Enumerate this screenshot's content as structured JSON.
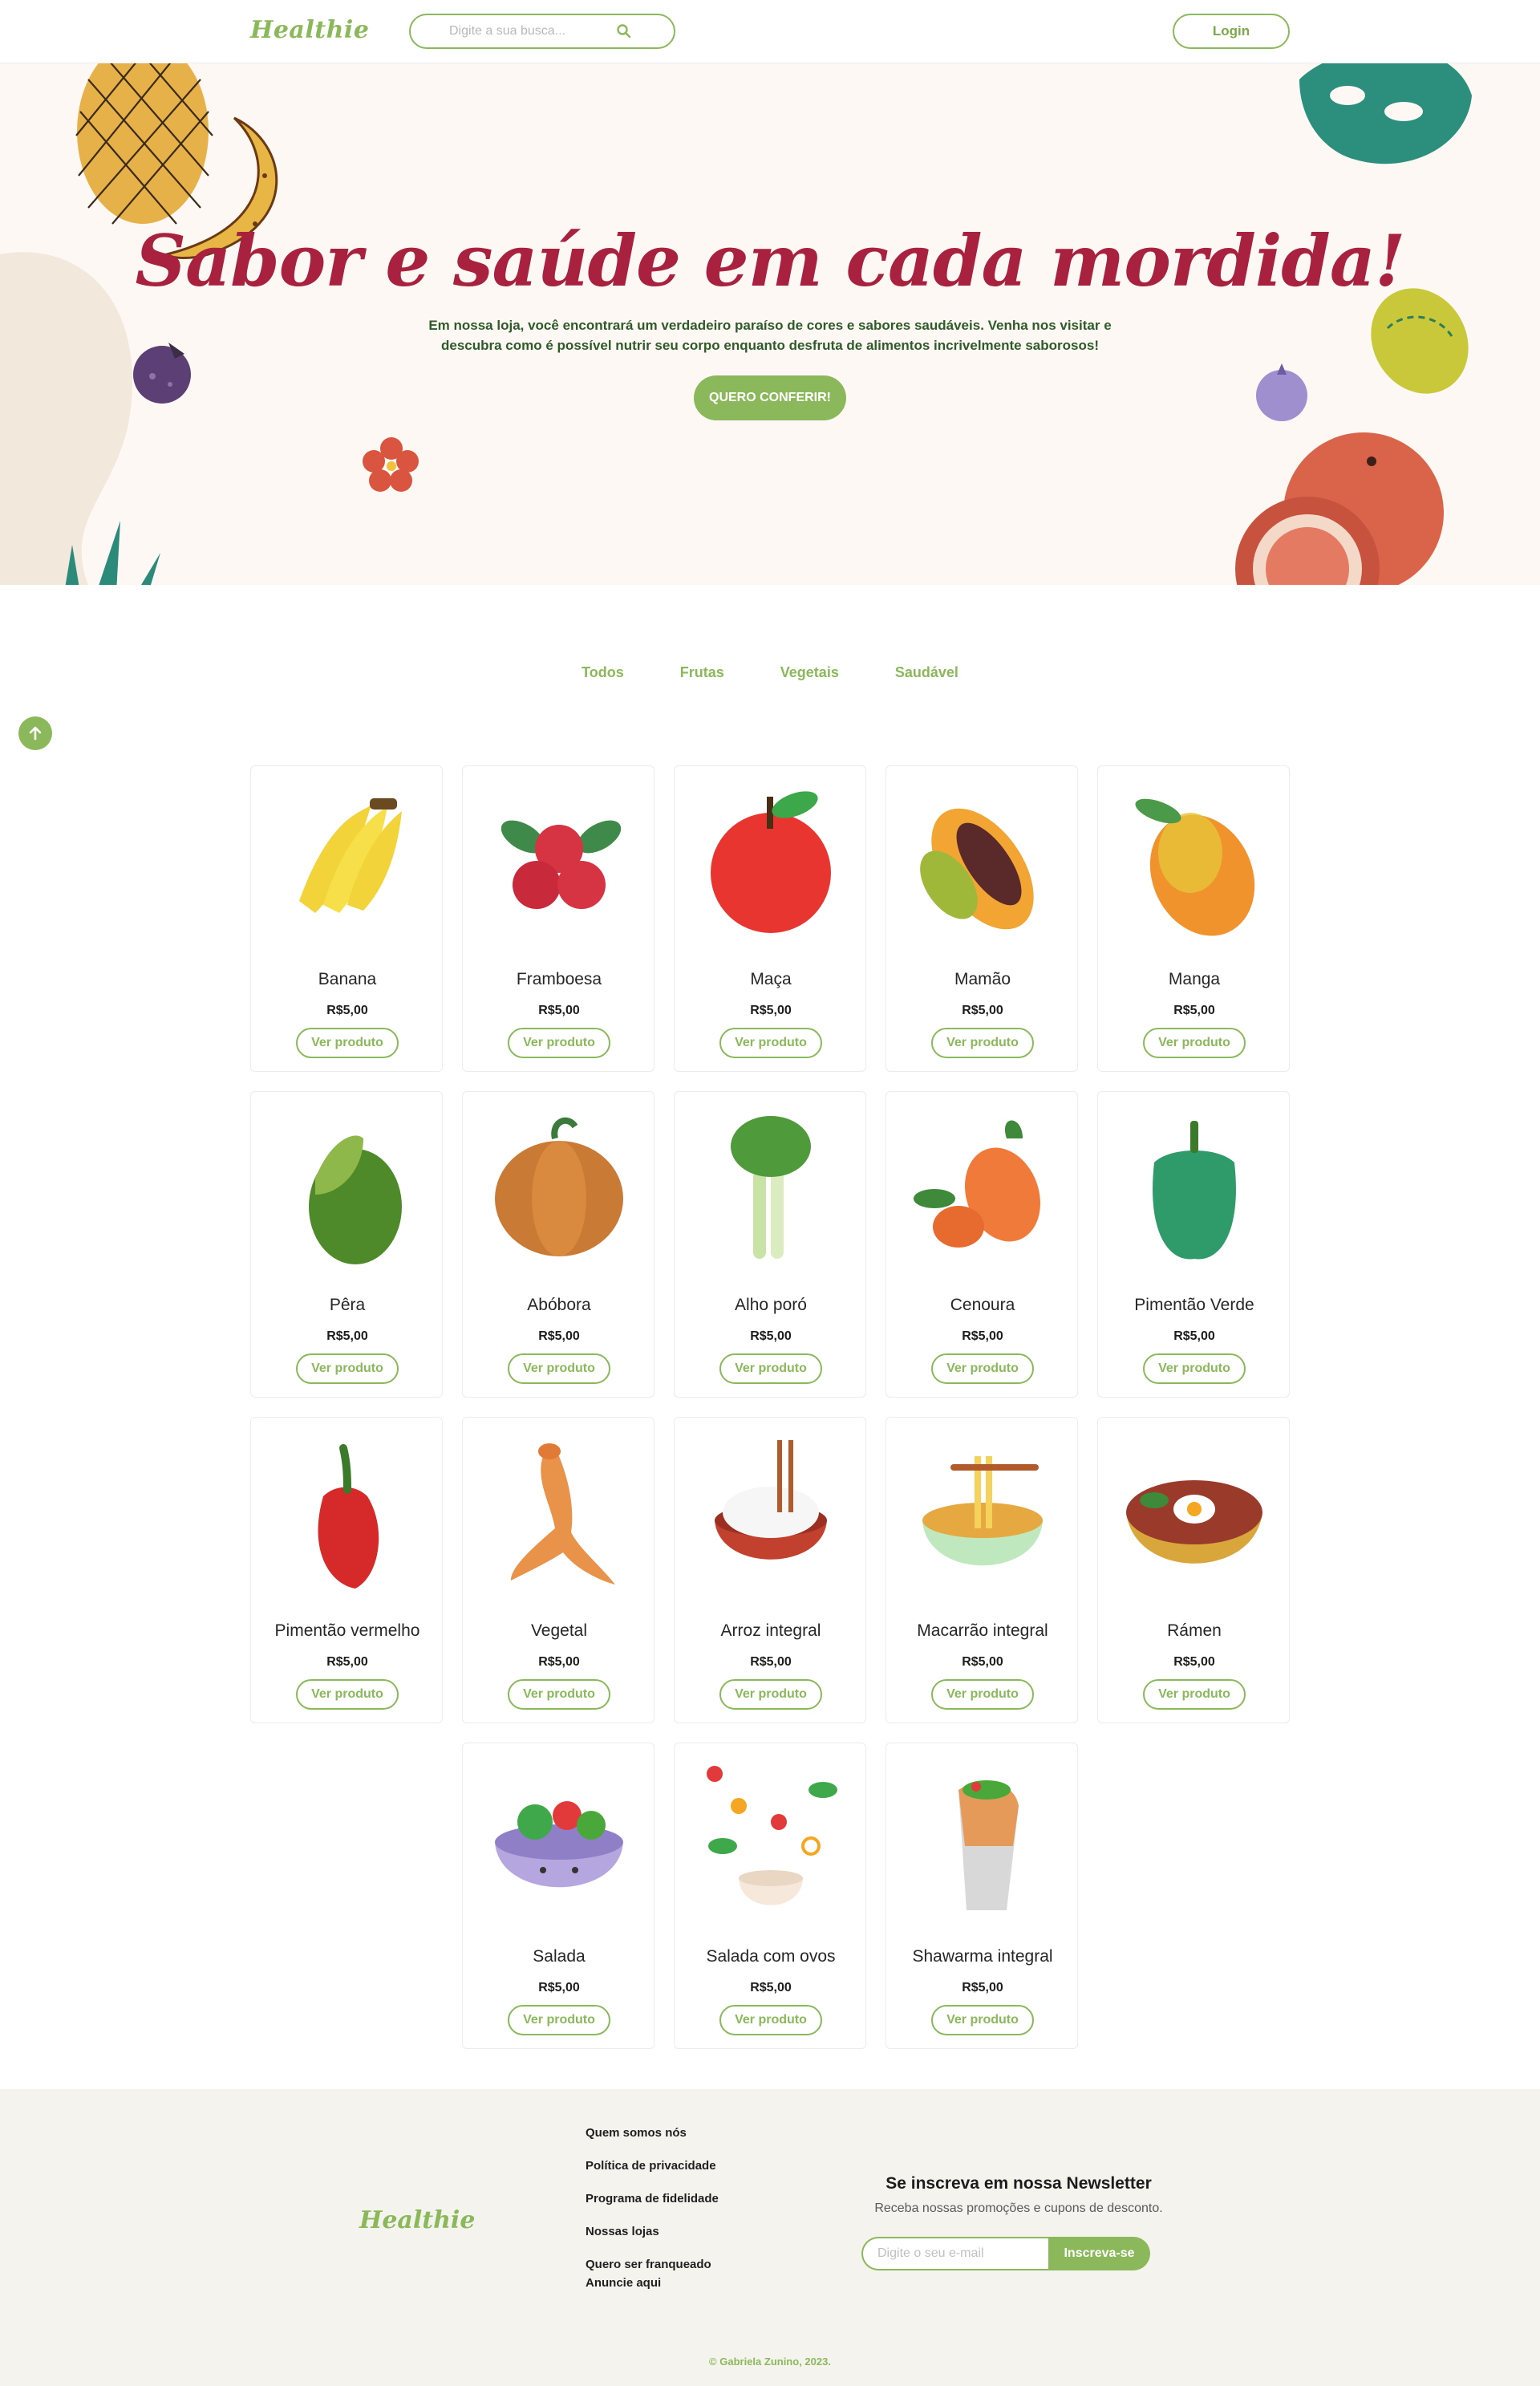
{
  "header": {
    "logo": "Healthie",
    "search_placeholder": "Digite a sua busca...",
    "login_label": "Login"
  },
  "hero": {
    "title": "Sabor e saúde em cada mordida!",
    "subtitle_line1": "Em nossa loja, você encontrará um verdadeiro paraíso de cores e sabores saudáveis. Venha nos visitar e",
    "subtitle_line2": "descubra como é possível nutrir seu corpo enquanto desfruta de alimentos incrivelmente saborosos!",
    "cta_label": "QUERO CONFERIR!"
  },
  "filters": [
    "Todos",
    "Frutas",
    "Vegetais",
    "Saudável"
  ],
  "product_button_label": "Ver produto",
  "products": [
    {
      "name": "Banana",
      "price": "R$5,00",
      "icon": "banana-icon"
    },
    {
      "name": "Framboesa",
      "price": "R$5,00",
      "icon": "raspberry-icon"
    },
    {
      "name": "Maça",
      "price": "R$5,00",
      "icon": "apple-icon"
    },
    {
      "name": "Mamão",
      "price": "R$5,00",
      "icon": "papaya-icon"
    },
    {
      "name": "Manga",
      "price": "R$5,00",
      "icon": "mango-icon"
    },
    {
      "name": "Pêra",
      "price": "R$5,00",
      "icon": "pear-icon"
    },
    {
      "name": "Abóbora",
      "price": "R$5,00",
      "icon": "pumpkin-icon"
    },
    {
      "name": "Alho poró",
      "price": "R$5,00",
      "icon": "leek-icon"
    },
    {
      "name": "Cenoura",
      "price": "R$5,00",
      "icon": "carrot-icon"
    },
    {
      "name": "Pimentão Verde",
      "price": "R$5,00",
      "icon": "green-pepper-icon"
    },
    {
      "name": "Pimentão vermelho",
      "price": "R$5,00",
      "icon": "red-pepper-icon"
    },
    {
      "name": "Vegetal",
      "price": "R$5,00",
      "icon": "root-vegetable-icon"
    },
    {
      "name": "Arroz integral",
      "price": "R$5,00",
      "icon": "rice-bowl-icon"
    },
    {
      "name": "Macarrão integral",
      "price": "R$5,00",
      "icon": "noodle-bowl-icon"
    },
    {
      "name": "Rámen",
      "price": "R$5,00",
      "icon": "ramen-bowl-icon"
    },
    {
      "name": "Salada",
      "price": "R$5,00",
      "icon": "salad-bowl-icon"
    },
    {
      "name": "Salada com ovos",
      "price": "R$5,00",
      "icon": "egg-salad-icon"
    },
    {
      "name": "Shawarma integral",
      "price": "R$5,00",
      "icon": "shawarma-icon"
    }
  ],
  "footer": {
    "logo": "Healthie",
    "links": [
      "Quem somos nós",
      "Política de privacidade",
      "Programa de fidelidade",
      "Nossas lojas",
      "Quero ser franqueado",
      "Anuncie aqui"
    ],
    "newsletter_title": "Se inscreva em nossa Newsletter",
    "newsletter_subtitle": "Receba nossas promoções e cupons de desconto.",
    "email_placeholder": "Digite o seu e-mail",
    "subscribe_label": "Inscreva-se",
    "copyright": "© Gabriela Zunino, 2023."
  },
  "colors": {
    "accent": "#8bb85a",
    "hero_title": "#a8213f",
    "hero_bg": "#fdf8f4",
    "footer_bg": "#f5f3ee"
  }
}
